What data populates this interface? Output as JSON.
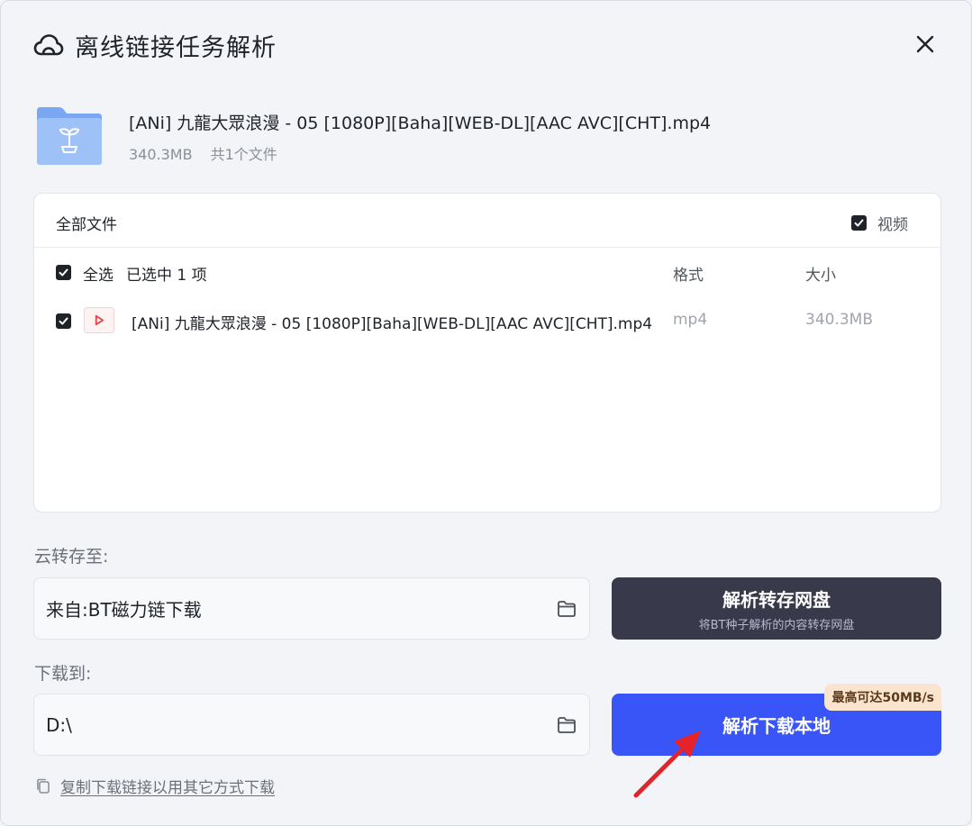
{
  "dialog": {
    "title": "离线链接任务解析"
  },
  "file": {
    "name": "[ANi] 九龍大眾浪漫 - 05 [1080P][Baha][WEB-DL][AAC AVC][CHT].mp4",
    "size": "340.3MB",
    "count": "共1个文件"
  },
  "list": {
    "title": "全部文件",
    "filter_label": "视频",
    "select_all": "全选",
    "selected_text": "已选中  1  项",
    "col_format": "格式",
    "col_size": "大小",
    "rows": [
      {
        "name": "[ANi] 九龍大眾浪漫 - 05 [1080P][Baha][WEB-DL][AAC AVC][CHT].mp4",
        "format": "mp4",
        "size": "340.3MB"
      }
    ]
  },
  "cloud_save": {
    "label": "云转存至:",
    "value": "来自:BT磁力链下载"
  },
  "download": {
    "label": "下载到:",
    "value": "D:\\"
  },
  "buttons": {
    "cloud_main": "解析转存网盘",
    "cloud_sub": "将BT种子解析的内容转存网盘",
    "local_main": "解析下载本地",
    "speed_badge": "最高可达50MB/s"
  },
  "copy_link": "复制下载链接以用其它方式下载",
  "colors": {
    "primary": "#3a55f7",
    "dark_button": "#383a4c",
    "badge_bg": "#fbe4cd",
    "arrow": "#e5232b"
  },
  "icons": [
    "cloud-icon",
    "close-icon",
    "folder-icon",
    "checkbox-icon",
    "video-file-icon",
    "copy-icon",
    "red-arrow-annotation"
  ]
}
